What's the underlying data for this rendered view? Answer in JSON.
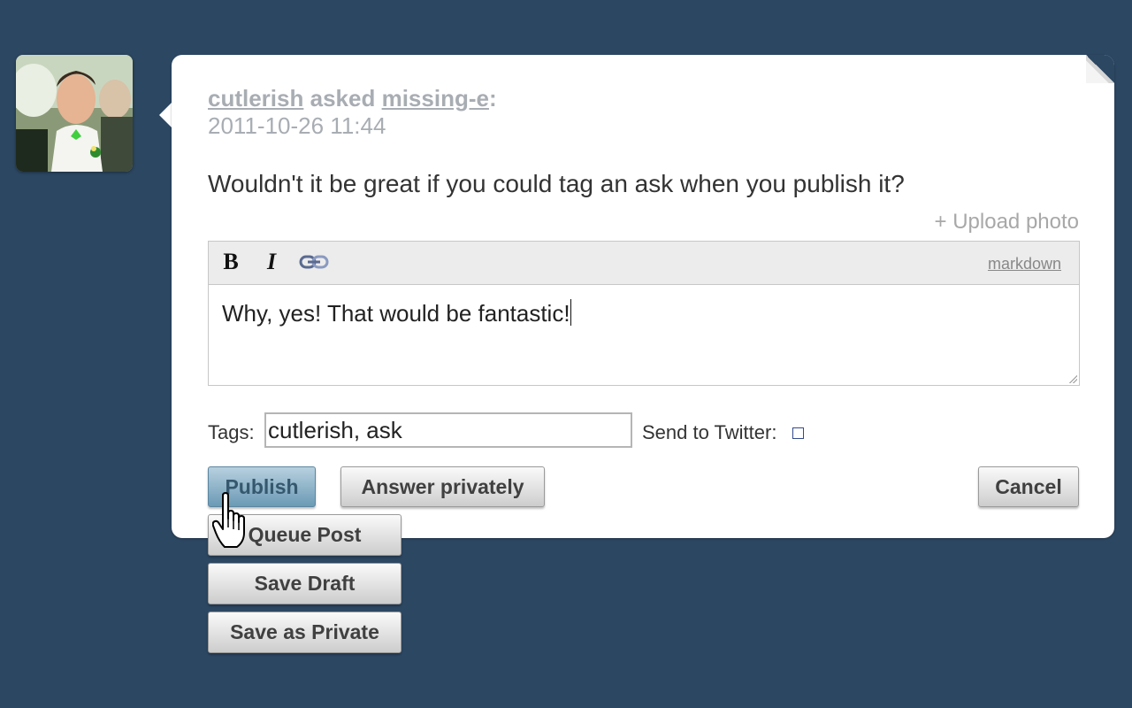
{
  "post": {
    "asker": "cutlerish",
    "verb": "asked",
    "recipient": "missing-e",
    "colon": ":",
    "timestamp": "2011-10-26 11:44",
    "question": "Wouldn't it be great if you could tag an ask when you publish it?",
    "upload_photo": "+ Upload photo"
  },
  "editor": {
    "bold_label": "B",
    "italic_label": "I",
    "markdown_link": "markdown",
    "answer_text": "Why, yes! That would be fantastic!"
  },
  "tags": {
    "label": "Tags:",
    "value": "cutlerish, ask"
  },
  "twitter": {
    "label": "Send to Twitter:",
    "checked": false
  },
  "buttons": {
    "publish": "Publish",
    "answer_privately": "Answer privately",
    "cancel": "Cancel"
  },
  "publish_menu": {
    "items": [
      "Queue Post",
      "Save Draft",
      "Save as Private"
    ]
  },
  "colors": {
    "background": "#2c4762",
    "card": "#ffffff",
    "publish_button": "#7fa8c0",
    "muted_text": "#a8adb3"
  },
  "icons": [
    "link-icon",
    "resize-handle-icon",
    "hand-pointer-cursor-icon"
  ]
}
